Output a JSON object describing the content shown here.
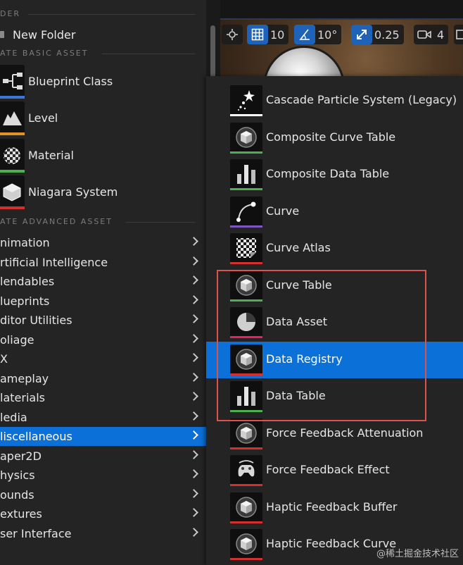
{
  "left_menu": {
    "folder_header": "DER",
    "new_folder": "New Folder",
    "basic_header": "ATE BASIC ASSET",
    "basic_items": [
      {
        "label": "Blueprint Class",
        "icon": "blueprint-class-icon",
        "color": "#3a78d6"
      },
      {
        "label": "Level",
        "icon": "level-icon",
        "color": "#e0922a"
      },
      {
        "label": "Material",
        "icon": "material-icon",
        "color": "#4caf50"
      },
      {
        "label": "Niagara System",
        "icon": "niagara-system-icon",
        "color": "#d32f2f"
      }
    ],
    "advanced_header": "ATE ADVANCED ASSET",
    "advanced_items": [
      "nimation",
      "rtificial Intelligence",
      "lendables",
      "lueprints",
      "ditor Utilities",
      "oliage",
      "X",
      "ameplay",
      "laterials",
      "ledia",
      "liscellaneous",
      "aper2D",
      "hysics",
      "ounds",
      "extures",
      "ser Interface"
    ],
    "selected_advanced": "liscellaneous"
  },
  "viewport": {
    "grid_snap": "10",
    "rotation_snap": "10°",
    "scale_snap": "0.25",
    "camera_speed": "4"
  },
  "submenu": {
    "items": [
      {
        "label": "Cascade Particle System (Legacy)",
        "icon": "cascade-particle-icon",
        "color": "#ffffff"
      },
      {
        "label": "Composite Curve Table",
        "icon": "composite-curve-table-icon",
        "color": "#4caf50"
      },
      {
        "label": "Composite Data Table",
        "icon": "composite-data-table-icon",
        "color": "#4caf50"
      },
      {
        "label": "Curve",
        "icon": "curve-icon",
        "color": "#7e57c2"
      },
      {
        "label": "Curve Atlas",
        "icon": "curve-atlas-icon",
        "color": "#d32f2f"
      },
      {
        "label": "Curve Table",
        "icon": "curve-table-icon",
        "color": "#4caf50"
      },
      {
        "label": "Data Asset",
        "icon": "data-asset-icon",
        "color": "#e91e63"
      },
      {
        "label": "Data Registry",
        "icon": "data-registry-icon",
        "color": "#d32f2f"
      },
      {
        "label": "Data Table",
        "icon": "data-table-icon",
        "color": "#4caf50"
      },
      {
        "label": "Force Feedback Attenuation",
        "icon": "force-feedback-attenuation-icon",
        "color": "#d32f2f"
      },
      {
        "label": "Force Feedback Effect",
        "icon": "force-feedback-effect-icon",
        "color": "#d32f2f"
      },
      {
        "label": "Haptic Feedback Buffer",
        "icon": "haptic-feedback-buffer-icon",
        "color": "#d32f2f"
      },
      {
        "label": "Haptic Feedback Curve",
        "icon": "haptic-feedback-curve-icon",
        "color": "#d32f2f"
      }
    ],
    "selected": "Data Registry"
  },
  "watermark": "@稀土掘金技术社区"
}
